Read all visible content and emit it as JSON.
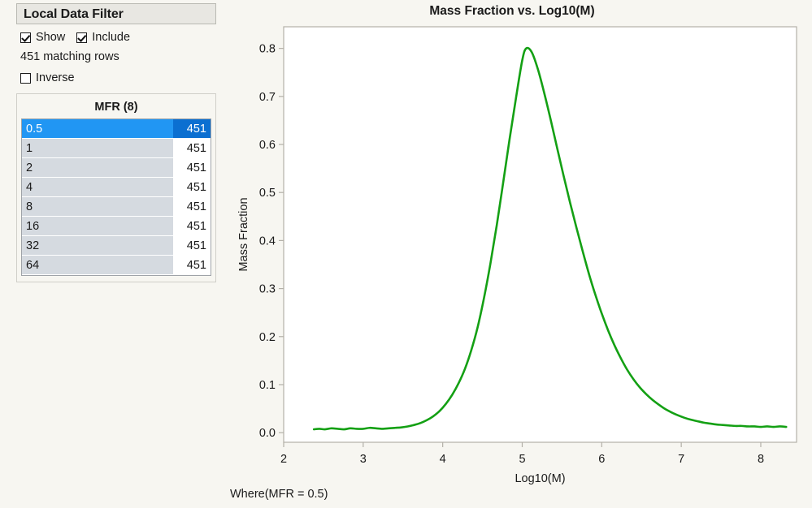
{
  "filter_panel": {
    "title": "Local Data Filter",
    "show_label": "Show",
    "show_checked": true,
    "include_label": "Include",
    "include_checked": true,
    "matching_rows_text": "451 matching rows",
    "inverse_label": "Inverse",
    "inverse_checked": false,
    "list": {
      "heading": "MFR (8)",
      "selected_index": 0,
      "rows": [
        {
          "value": "0.5",
          "count": "451"
        },
        {
          "value": "1",
          "count": "451"
        },
        {
          "value": "2",
          "count": "451"
        },
        {
          "value": "4",
          "count": "451"
        },
        {
          "value": "8",
          "count": "451"
        },
        {
          "value": "16",
          "count": "451"
        },
        {
          "value": "32",
          "count": "451"
        },
        {
          "value": "64",
          "count": "451"
        }
      ]
    }
  },
  "footer": {
    "where_text": "Where(MFR = 0.5)"
  },
  "colors": {
    "background": "#f7f6f1",
    "curve": "#14a014",
    "selection_blue": "#2196f3",
    "selection_blue_dark": "#0b6fd1",
    "row_bar_gray": "#d5dae0",
    "axis_gray": "#b3b0a8"
  },
  "chart_data": {
    "type": "line",
    "title": "Mass Fraction vs. Log10(M)",
    "xlabel": "Log10(M)",
    "ylabel": "Mass Fraction",
    "xlim": [
      2.0,
      8.45
    ],
    "ylim": [
      -0.02,
      0.845
    ],
    "xticks": [
      2,
      3,
      4,
      5,
      6,
      7,
      8
    ],
    "xtick_labels": [
      "2",
      "3",
      "4",
      "5",
      "6",
      "7",
      "8"
    ],
    "yticks": [
      0.0,
      0.1,
      0.2,
      0.3,
      0.4,
      0.5,
      0.6,
      0.7,
      0.8
    ],
    "ytick_labels": [
      "0.0",
      "0.1",
      "0.2",
      "0.3",
      "0.4",
      "0.5",
      "0.6",
      "0.7",
      "0.8"
    ],
    "grid": false,
    "legend": null,
    "series": [
      {
        "name": "Mass Fraction",
        "color": "#14a014",
        "x": [
          2.38,
          2.45,
          2.52,
          2.6,
          2.68,
          2.76,
          2.84,
          2.92,
          3.0,
          3.08,
          3.16,
          3.24,
          3.32,
          3.4,
          3.48,
          3.56,
          3.64,
          3.72,
          3.8,
          3.88,
          3.96,
          4.04,
          4.12,
          4.2,
          4.28,
          4.36,
          4.44,
          4.52,
          4.6,
          4.68,
          4.76,
          4.84,
          4.92,
          5.0,
          5.05,
          5.12,
          5.2,
          5.28,
          5.36,
          5.44,
          5.52,
          5.6,
          5.68,
          5.76,
          5.84,
          5.92,
          6.0,
          6.08,
          6.16,
          6.24,
          6.32,
          6.4,
          6.48,
          6.56,
          6.64,
          6.72,
          6.8,
          6.88,
          6.96,
          7.04,
          7.12,
          7.2,
          7.28,
          7.36,
          7.44,
          7.52,
          7.6,
          7.68,
          7.76,
          7.84,
          7.92,
          8.0,
          8.08,
          8.16,
          8.24,
          8.32
        ],
        "y": [
          0.007,
          0.008,
          0.007,
          0.009,
          0.008,
          0.007,
          0.009,
          0.008,
          0.008,
          0.01,
          0.009,
          0.008,
          0.009,
          0.01,
          0.011,
          0.013,
          0.016,
          0.02,
          0.026,
          0.034,
          0.045,
          0.06,
          0.079,
          0.103,
          0.133,
          0.172,
          0.22,
          0.281,
          0.352,
          0.432,
          0.52,
          0.61,
          0.695,
          0.775,
          0.8,
          0.792,
          0.755,
          0.705,
          0.65,
          0.592,
          0.535,
          0.48,
          0.428,
          0.378,
          0.33,
          0.287,
          0.248,
          0.213,
          0.182,
          0.155,
          0.131,
          0.111,
          0.094,
          0.08,
          0.068,
          0.058,
          0.049,
          0.042,
          0.036,
          0.031,
          0.027,
          0.024,
          0.021,
          0.019,
          0.017,
          0.016,
          0.015,
          0.014,
          0.014,
          0.013,
          0.013,
          0.012,
          0.013,
          0.012,
          0.013,
          0.012
        ]
      }
    ]
  }
}
